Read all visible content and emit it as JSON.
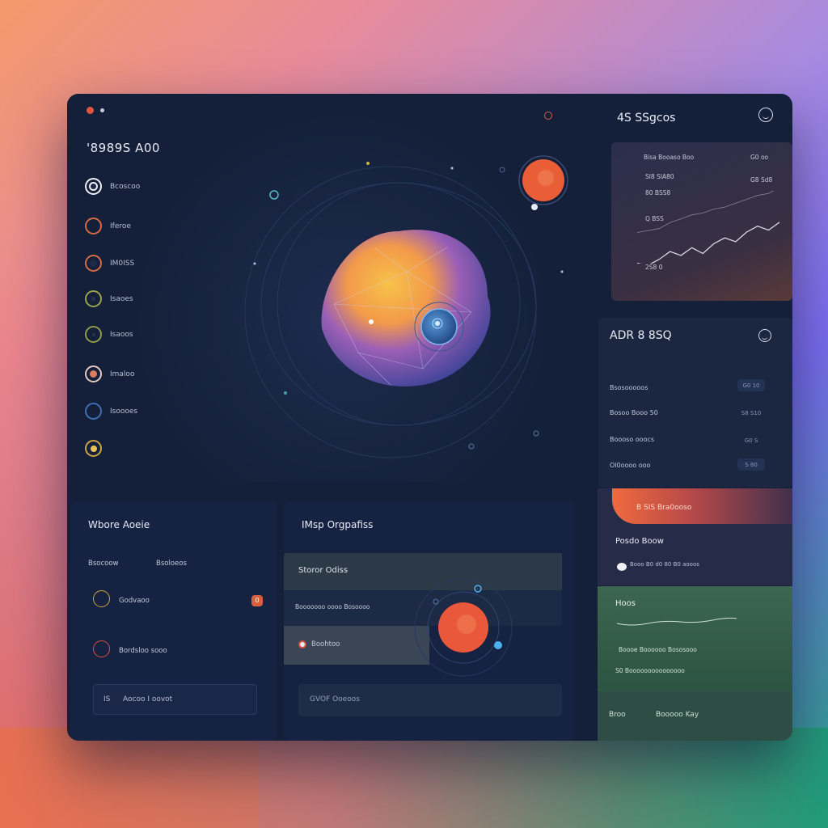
{
  "window": {
    "brand": "'8989S A00"
  },
  "sidebar": {
    "items": [
      {
        "label": "Bcoscoo",
        "icon": "ring-white-icon"
      },
      {
        "label": "Iferoe",
        "icon": "ring-orange-icon"
      },
      {
        "label": "IM0ISS",
        "icon": "ring-orange-icon"
      },
      {
        "label": "Isaoes",
        "icon": "ring-olive-icon"
      },
      {
        "label": "Isaoos",
        "icon": "ring-olive-icon"
      },
      {
        "label": "Imaloo",
        "icon": "ring-peach-icon"
      },
      {
        "label": "Isoooes",
        "icon": "ring-blue-icon"
      },
      {
        "label": "",
        "icon": "ring-gold-icon"
      }
    ]
  },
  "header": {
    "right_title": "4S SSgcos"
  },
  "chart_card": {
    "top_label": "Bisa Booaso Boo",
    "top_value": "G0 oo",
    "sub1": "Sl8 SIA80",
    "sub1_value": "G8 Sd8",
    "sub2": "80 BSS8",
    "mid_label": "Q BSS",
    "bottom_label": "2S8 0",
    "chart_data": {
      "type": "line",
      "series": [
        {
          "values": [
            10,
            8,
            14,
            22,
            18,
            26,
            20,
            30,
            36,
            32,
            42,
            48,
            44,
            52
          ]
        },
        {
          "values": [
            20,
            22,
            24,
            30,
            34,
            38,
            40,
            44,
            46,
            50,
            54,
            58,
            60,
            66
          ]
        }
      ]
    }
  },
  "card2": {
    "title": "ADR 8 8SQ",
    "rows": [
      {
        "label": "Bsosooooos",
        "value": "G0 10"
      },
      {
        "label": "Bosoo Booo 50",
        "value": "S8 S10"
      },
      {
        "label": "Boooso ooocs",
        "value": "G0 S"
      },
      {
        "label": "Ol0oooo ooo",
        "value": "S 80"
      }
    ]
  },
  "card3": {
    "banner": "B SIS Bra0ooso",
    "title": "Posdo Boow",
    "sub": "Booo B0 d0 80 B0 aooos"
  },
  "card4": {
    "title": "Hoos",
    "line1": "Boooe Boooooo Bososooo",
    "line2": "S0 Booooooooooooooo",
    "footer_left": "Broo",
    "footer_right": "Booooo Kay"
  },
  "panel_left": {
    "title": "Wbore Aoeie",
    "col1": "Bsocoow",
    "col2": "Bsoloeos",
    "row1": "Godvaoo",
    "row1_badge": "0",
    "row2": "Bordsloo sooo",
    "input_prefix": "IS",
    "input_value": "Aocoo I oovot"
  },
  "panel_mid": {
    "title": "IMsp Orgpafiss",
    "band_label": "Storor Odiss",
    "row1_label": "Booooooo oooo Bosoooo",
    "row2_label": "Boohtoo",
    "input_value": "GVOF Ooeoos"
  },
  "colors": {
    "window_bg": "#14203a",
    "accent_orange": "#f06a3e",
    "accent_green": "#3d6650",
    "accent_blue": "#4a8fd8"
  }
}
